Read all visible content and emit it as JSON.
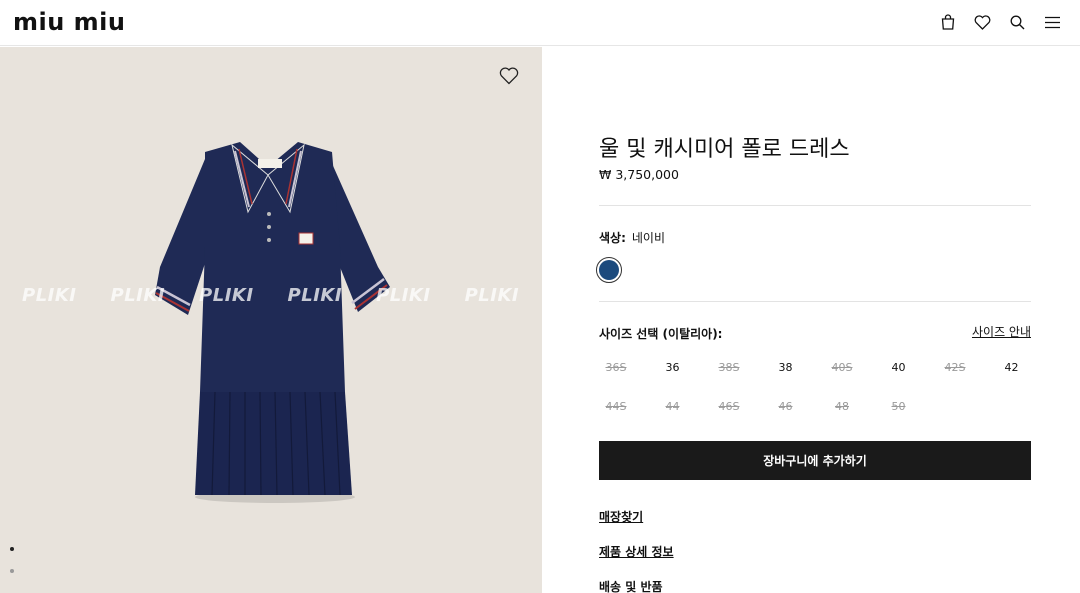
{
  "header": {
    "logo": "miu miu",
    "icons": [
      "bag-icon",
      "heart-icon",
      "search-icon",
      "menu-icon"
    ]
  },
  "gallery": {
    "watermark": [
      "PLIKI",
      "PLIKI",
      "PLIKI",
      "PLIKI",
      "PLIKI",
      "PLIKI"
    ],
    "image_desc_color": "#1f2a55"
  },
  "product": {
    "title": "울 및 캐시미어 폴로 드레스",
    "price": "₩ 3,750,000",
    "color_label": "색상:",
    "color_value": "네이비",
    "swatch_color": "#1c4a7d",
    "size_heading": "사이즈 선택 (이탈리아):",
    "size_guide": "사이즈 안내",
    "sizes": [
      {
        "label": "36S",
        "available": false
      },
      {
        "label": "36",
        "available": true
      },
      {
        "label": "38S",
        "available": false
      },
      {
        "label": "38",
        "available": true
      },
      {
        "label": "40S",
        "available": false
      },
      {
        "label": "40",
        "available": true
      },
      {
        "label": "42S",
        "available": false
      },
      {
        "label": "42",
        "available": true
      },
      {
        "label": "44S",
        "available": false
      },
      {
        "label": "44",
        "available": false
      },
      {
        "label": "46S",
        "available": false
      },
      {
        "label": "46",
        "available": false
      },
      {
        "label": "48",
        "available": false
      },
      {
        "label": "50",
        "available": false
      }
    ],
    "add_to_cart": "장바구니에 추가하기",
    "links": {
      "store": "매장찾기",
      "details": "제품 상세 정보",
      "shipping": "배송 및 반품"
    }
  }
}
